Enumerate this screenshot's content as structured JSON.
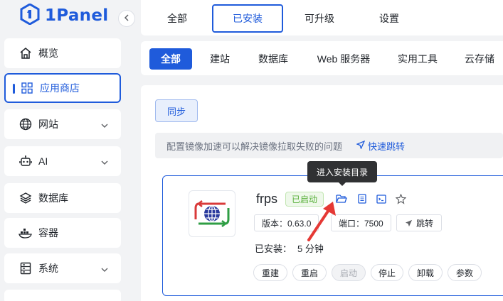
{
  "brand": {
    "name": "1Panel",
    "color": "#1f5bdb"
  },
  "sidebar": {
    "items": [
      {
        "label": "概览",
        "icon": "home-icon"
      },
      {
        "label": "应用商店",
        "icon": "grid-icon",
        "active": true
      },
      {
        "label": "网站",
        "icon": "globe-icon"
      },
      {
        "label": "AI",
        "icon": "robot-icon"
      },
      {
        "label": "数据库",
        "icon": "layers-icon"
      },
      {
        "label": "容器",
        "icon": "docker-icon"
      },
      {
        "label": "系统",
        "icon": "server-icon"
      }
    ]
  },
  "top_tabs": [
    {
      "label": "全部"
    },
    {
      "label": "已安装",
      "active": true
    },
    {
      "label": "可升级"
    },
    {
      "label": "设置"
    }
  ],
  "categories": [
    {
      "label": "全部",
      "active": true
    },
    {
      "label": "建站"
    },
    {
      "label": "数据库"
    },
    {
      "label": "Web 服务器"
    },
    {
      "label": "实用工具"
    },
    {
      "label": "云存储"
    }
  ],
  "main": {
    "sync_label": "同步",
    "notice_text": "配置镜像加速可以解决镜像拉取失败的问题",
    "quick_jump": "快速跳转"
  },
  "app": {
    "name": "frps",
    "status": "已启动",
    "version_label": "版本：0.63.0",
    "port_label": "端口：7500",
    "jump_label": "跳转",
    "installed_label": "已安装：",
    "installed_value": "5 分钟",
    "actions": [
      "重建",
      "重启",
      "启动",
      "停止",
      "卸载",
      "参数"
    ],
    "tooltip": "进入安装目录"
  }
}
